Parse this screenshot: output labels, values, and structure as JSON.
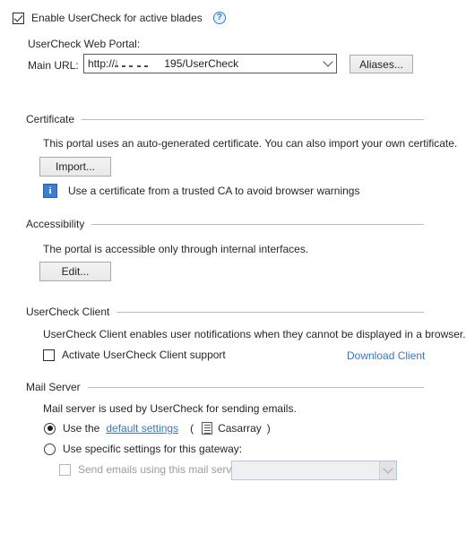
{
  "enable": {
    "label": "Enable UserCheck for active blades",
    "checked": true,
    "help_icon": "help-circle-icon",
    "help_glyph": "?"
  },
  "web_portal": {
    "section_label": "UserCheck Web Portal:",
    "main_url_label": "Main URL:",
    "main_url_value_prefix": "http://",
    "main_url_value_suffix": "195/UserCheck",
    "main_url_redacted": true,
    "aliases_button": "Aliases..."
  },
  "certificate": {
    "group_title": "Certificate",
    "description": "This portal uses an auto-generated certificate. You can also import your own certificate.",
    "import_button": "Import...",
    "info_icon": "info-square-icon",
    "info_glyph": "i",
    "info_text": "Use a certificate from a trusted CA to avoid browser warnings"
  },
  "accessibility": {
    "group_title": "Accessibility",
    "description": "The portal is accessible only through internal interfaces.",
    "edit_button": "Edit..."
  },
  "usercheck_client": {
    "group_title": "UserCheck Client",
    "description": "UserCheck Client enables user notifications when they cannot be displayed in a browser.",
    "activate_label": "Activate UserCheck Client support",
    "activate_checked": false,
    "download_link": "Download Client"
  },
  "mail_server": {
    "group_title": "Mail Server",
    "description": "Mail server is used by UserCheck for sending emails.",
    "option_default": {
      "prefix": "Use the",
      "link": "default settings",
      "paren_open": "(",
      "object_icon": "document-icon",
      "object_name": "Casarray",
      "paren_close": ")",
      "selected": true
    },
    "option_specific": {
      "label": "Use specific settings for this gateway:",
      "selected": false
    },
    "send_emails": {
      "label": "Send emails using this mail server:",
      "checked": false,
      "disabled": true,
      "combo_value": "",
      "combo_placeholder": ""
    }
  },
  "colors": {
    "link": "#3a76c8",
    "accent_info": "#3b7fd4",
    "group_rule": "#b9bcbf",
    "text": "#24272b",
    "disabled_text": "#9a9da1"
  }
}
